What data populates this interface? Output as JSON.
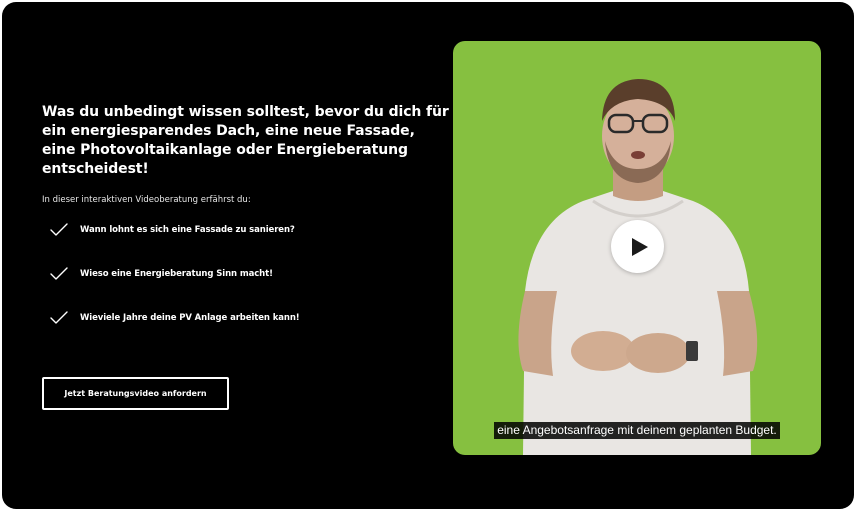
{
  "headline": [
    "Was du unbedingt wissen solltest, bevor du dich für",
    "ein energiesparendes Dach, eine neue Fassade,",
    "eine Photovoltaikanlage oder Energieberatung",
    "entscheidest!"
  ],
  "intro": "In dieser interaktiven Videoberatung erfährst du:",
  "bullets": [
    {
      "icon": "checkmark-icon",
      "text": "Wann lohnt es sich eine Fassade zu sanieren?"
    },
    {
      "icon": "checkmark-icon",
      "text": "Wieso eine Energieberatung Sinn macht!"
    },
    {
      "icon": "checkmark-icon",
      "text": "Wieviele Jahre deine PV Anlage arbeiten kann!"
    }
  ],
  "cta_label": "Jetzt Beratungsvideo anfordern",
  "video": {
    "play_icon": "play-icon",
    "caption": "eine Angebotsanfrage mit deinem geplanten Budget."
  },
  "colors": {
    "background": "#000000",
    "video_background": "#86c040",
    "text": "#ffffff"
  }
}
